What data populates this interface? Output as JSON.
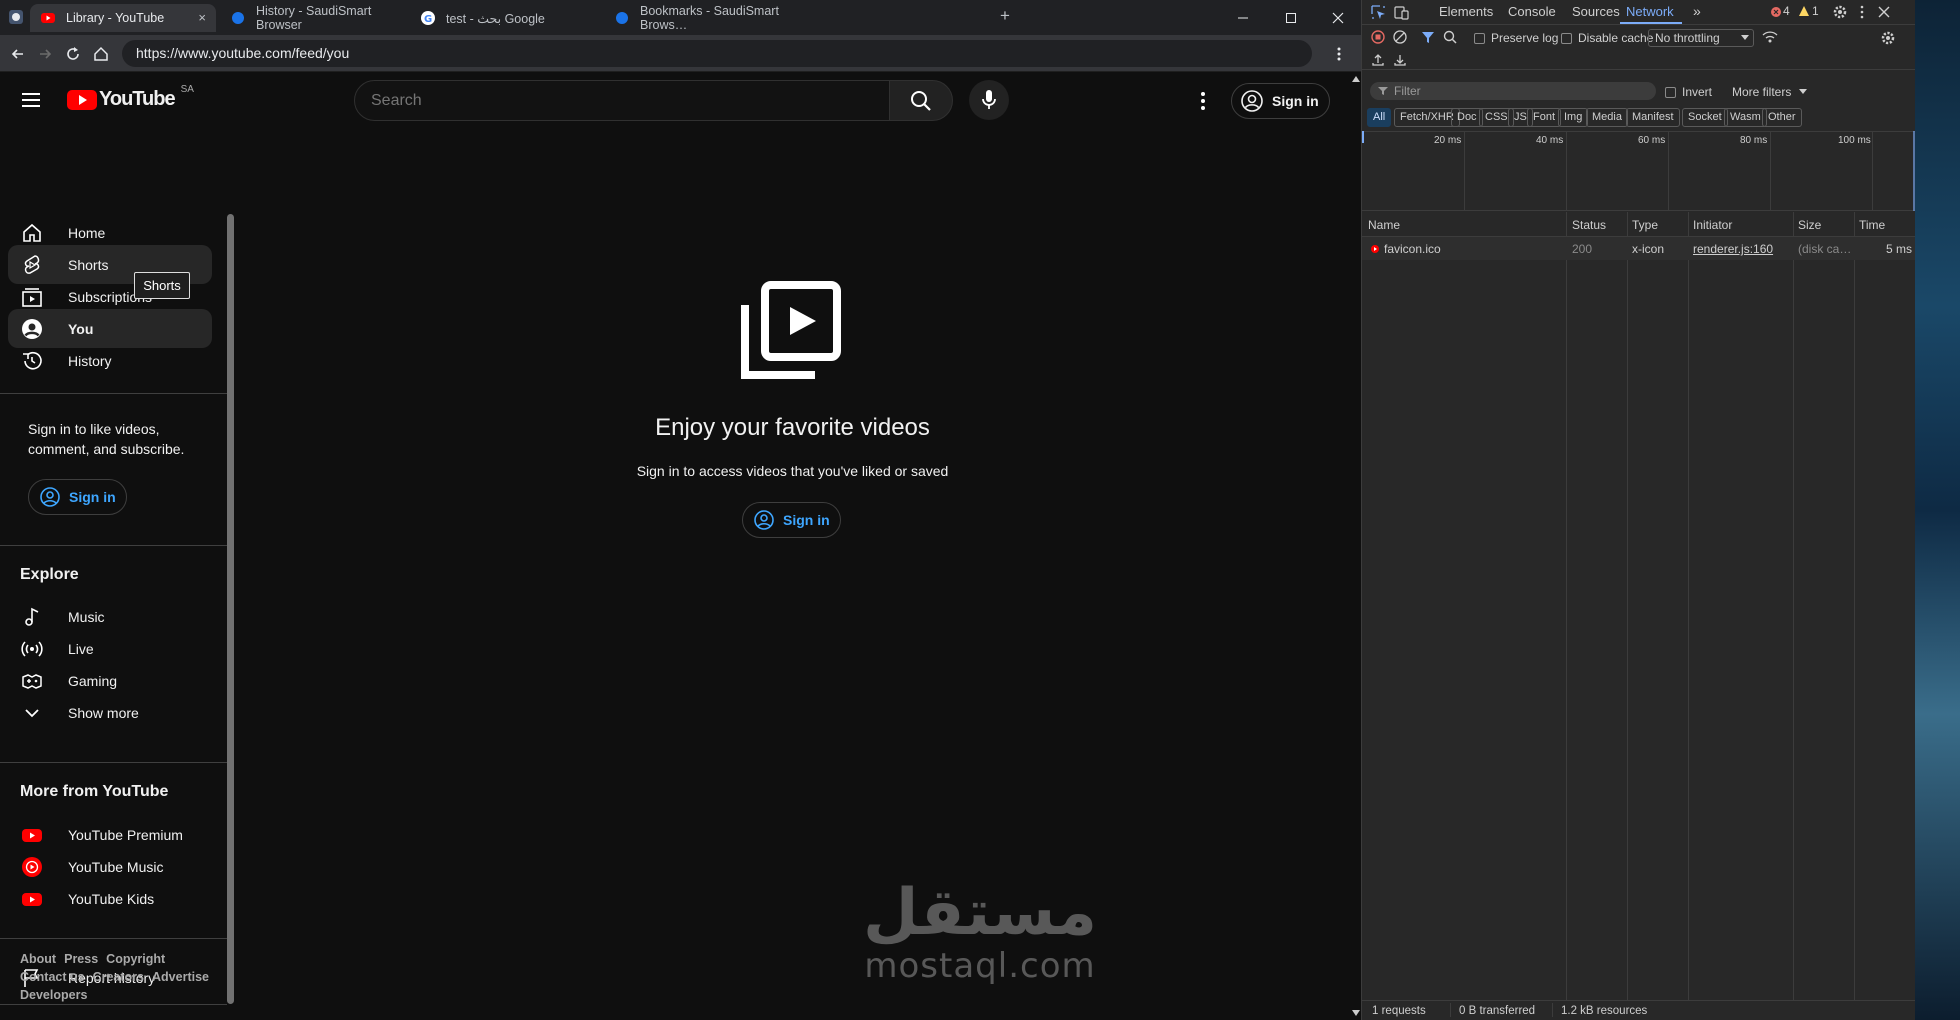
{
  "browser": {
    "tabs": [
      {
        "title": "Library - YouTube",
        "active": true
      },
      {
        "title": "History - SaudiSmart Browser",
        "active": false
      },
      {
        "title": "test - بحث Google",
        "active": false
      },
      {
        "title": "Bookmarks - SaudiSmart Brows…",
        "active": false
      }
    ],
    "new_tab": "+",
    "close_tab": "×",
    "url": "https://www.youtube.com/feed/you"
  },
  "youtube": {
    "logo_text": "YouTube",
    "region": "SA",
    "search_placeholder": "Search",
    "signin_top": "Sign in",
    "sidebar": {
      "main_items": [
        "Home",
        "Shorts",
        "Subscriptions",
        "You",
        "History"
      ],
      "signin_prompt": "Sign in to like videos, comment, and subscribe.",
      "signin": "Sign in",
      "explore_title": "Explore",
      "explore_items": [
        "Music",
        "Live",
        "Gaming",
        "Show more"
      ],
      "more_title": "More from YouTube",
      "more_items": [
        "YouTube Premium",
        "YouTube Music",
        "YouTube Kids"
      ],
      "report_history": "Report history",
      "footer_line1": [
        "About",
        "Press",
        "Copyright"
      ],
      "footer_line2": [
        "Contact us",
        "Creators",
        "Advertise"
      ],
      "footer_line3": [
        "Developers"
      ]
    },
    "tooltip": "Shorts",
    "main": {
      "title": "Enjoy your favorite videos",
      "subtitle": "Sign in to access videos that you've liked or saved",
      "signin": "Sign in"
    }
  },
  "devtools": {
    "tabs": [
      "Elements",
      "Console",
      "Sources",
      "Network"
    ],
    "active_tab": "Network",
    "errors": "4",
    "warnings": "1",
    "preserve_log": "Preserve log",
    "disable_cache": "Disable cache",
    "throttling": "No throttling",
    "filter_placeholder": "Filter",
    "invert": "Invert",
    "more_filters": "More filters",
    "type_filters": [
      "All",
      "Fetch/XHR",
      "Doc",
      "CSS",
      "JS",
      "Font",
      "Img",
      "Media",
      "Manifest",
      "Socket",
      "Wasm",
      "Other"
    ],
    "timeline_labels": [
      "20 ms",
      "40 ms",
      "60 ms",
      "80 ms",
      "100 ms"
    ],
    "columns": [
      "Name",
      "Status",
      "Type",
      "Initiator",
      "Size",
      "Time"
    ],
    "rows": [
      {
        "name": "favicon.ico",
        "status": "200",
        "type": "x-icon",
        "initiator": "renderer.js:160",
        "size": "(disk ca…",
        "time": "5 ms"
      }
    ],
    "status_bar": [
      "1 requests",
      "0 B transferred",
      "1.2 kB resources"
    ]
  },
  "watermark": {
    "arabic": "مستقل",
    "latin": "mostaql.com"
  },
  "colors": {
    "yt_red": "#ff0000",
    "link_blue": "#3ea6ff",
    "devtools_blue": "#7cacf8"
  }
}
